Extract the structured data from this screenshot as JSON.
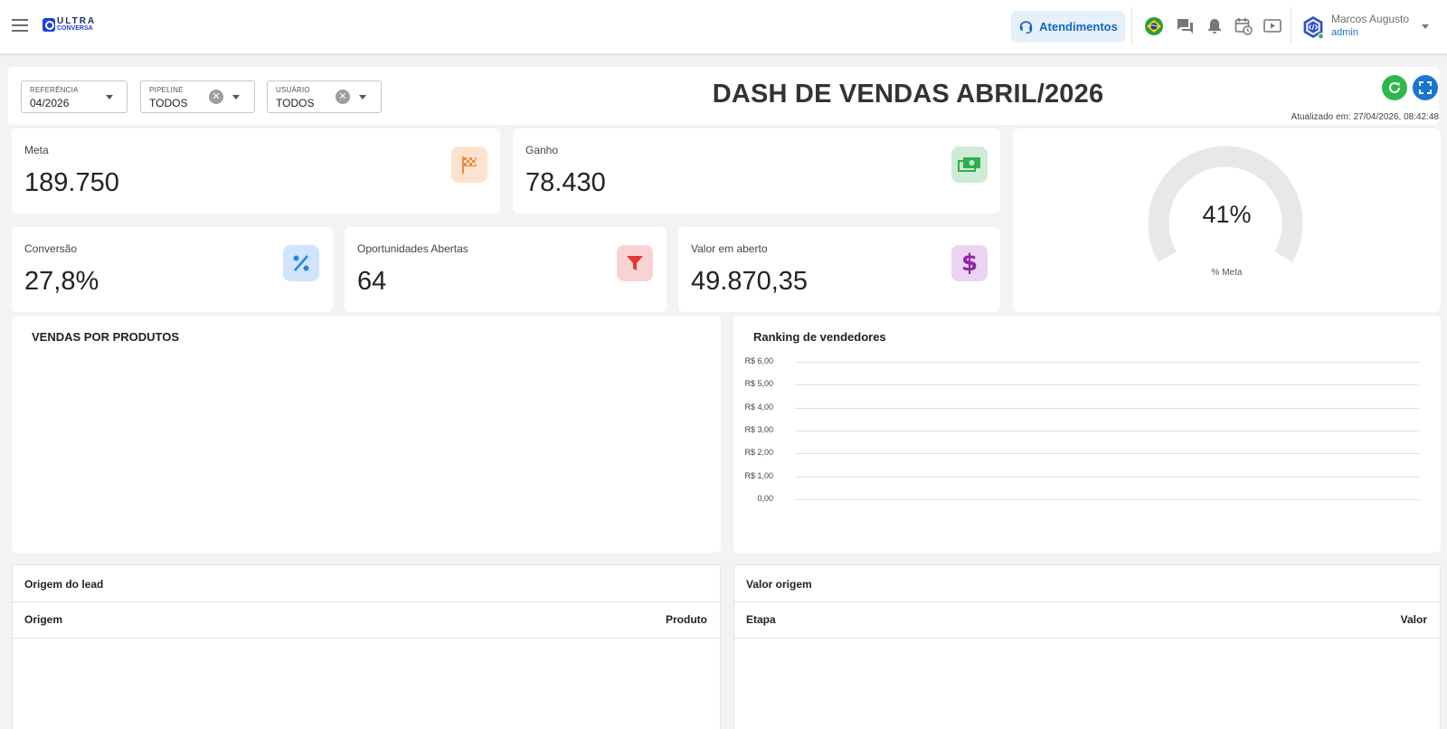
{
  "header": {
    "logo_line1": "ULTRA",
    "logo_line2": "CONVERSA",
    "atendimentos_label": "Atendimentos",
    "user_name": "Marcos Augusto",
    "user_role": "admin"
  },
  "filters": {
    "referencia": {
      "label": "REFERÊNCIA",
      "value": "04/2026"
    },
    "pipeline": {
      "label": "PIPELINE",
      "value": "TODOS"
    },
    "usuario": {
      "label": "USUÁRIO",
      "value": "TODOS"
    }
  },
  "dash": {
    "title": "DASH DE VENDAS ABRIL/2026",
    "updated": "Atualizado em: 27/04/2026, 08:42:48"
  },
  "kpis": {
    "meta": {
      "label": "Meta",
      "value": "189.750"
    },
    "ganho": {
      "label": "Ganho",
      "value": "78.430"
    },
    "conversao": {
      "label": "Conversão",
      "value": "27,8%"
    },
    "oportunidades": {
      "label": "Oportunidades Abertas",
      "value": "64"
    },
    "valor_aberto": {
      "label": "Valor em aberto",
      "value": "49.870,35"
    }
  },
  "gauge": {
    "percent_label": "41%",
    "caption": "% Meta",
    "fraction": 0.41
  },
  "vendas_produtos": {
    "title": "VENDAS POR PRODUTOS"
  },
  "ranking": {
    "title": "Ranking de vendedores",
    "ticks": [
      "R$ 6,00",
      "R$ 5,00",
      "R$ 4,00",
      "R$ 3,00",
      "R$ 2,00",
      "R$ 1,00",
      "0,00"
    ]
  },
  "origem_lead": {
    "title": "Origem do lead",
    "col1": "Origem",
    "col2": "Produto"
  },
  "valor_origem": {
    "title": "Valor origem",
    "col1": "Etapa",
    "col2": "Valor"
  },
  "colors": {
    "accent_blue": "#1976d2",
    "green": "#2eb84a",
    "orange": "#f08a3c",
    "red": "#e53935",
    "purple": "#8e24aa"
  }
}
